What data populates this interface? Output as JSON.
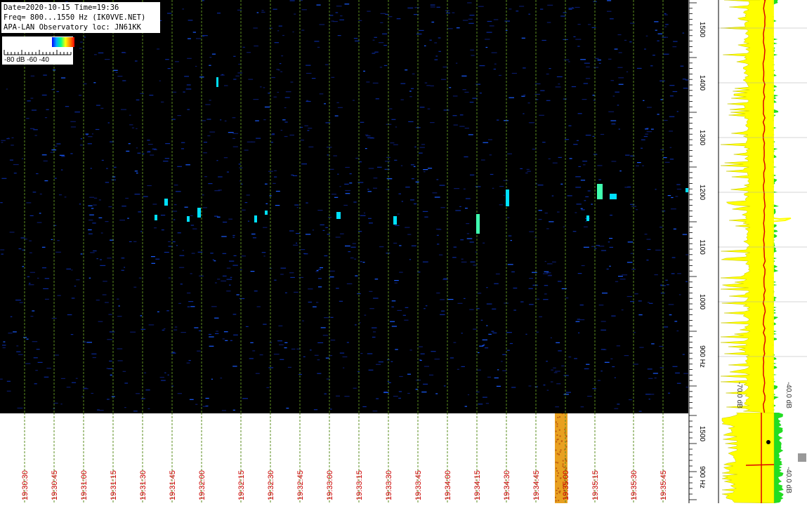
{
  "info": {
    "line1": "Date=2020-10-15 Time=19:36",
    "line2": "Freq= 800...1550 Hz (IK0VVE.NET)",
    "line3": "APA-LAN Observatory loc: JN61KK"
  },
  "legend": {
    "labels": "-80 dB -60     -40"
  },
  "freq_axis": {
    "ticks": [
      "1500",
      "1400",
      "1300",
      "1200",
      "1100",
      "1000",
      "900 Hz"
    ],
    "lower_ticks": [
      "1500",
      "900 Hz"
    ]
  },
  "time_axis": {
    "ticks": [
      "19:30:30",
      "19:30:45",
      "19:31:00",
      "19:31:15",
      "19:31:30",
      "19:31:45",
      "19:32:00",
      "19:32:15",
      "19:32:30",
      "19:32:45",
      "19:33:00",
      "19:33:15",
      "19:33:30",
      "19:33:45",
      "19:34:00",
      "19:34:15",
      "19:34:30",
      "19:34:45",
      "19:35:00",
      "19:35:15",
      "19:35:30",
      "19:35:45"
    ]
  },
  "spectrum": {
    "labels": [
      "-70.0 dB",
      "-40.0 dB"
    ],
    "lower_label": "-40.0 dB"
  },
  "colors": {
    "spectrogram_bg": "#000000",
    "grid_time": "#5a8c1e",
    "time_label": "#cc0000",
    "spectrum_fill": "#ffff00",
    "spectrum_noise": "#22dd22",
    "spectrum_mean": "#dd0000",
    "signal_cyan": "#00e0ff",
    "signal_blue": "#1060ff"
  }
}
